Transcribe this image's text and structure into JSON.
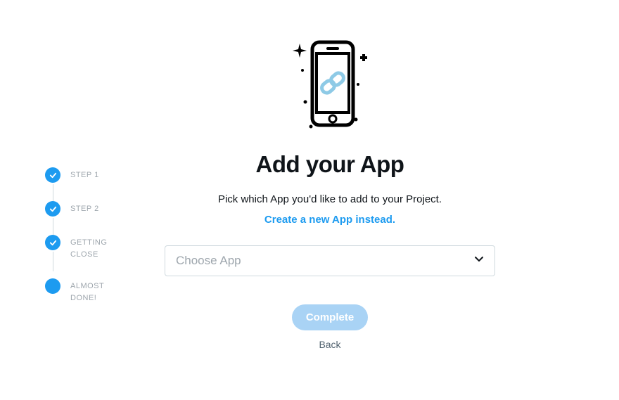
{
  "stepper": {
    "steps": [
      {
        "label": "STEP 1",
        "done": true
      },
      {
        "label": "STEP 2",
        "done": true
      },
      {
        "label": "GETTING CLOSE",
        "done": true
      },
      {
        "label": "ALMOST DONE!",
        "done": false
      }
    ]
  },
  "main": {
    "heading": "Add your App",
    "subtitle": "Pick which App you'd like to add to your Project.",
    "create_link": "Create a new App instead.",
    "select_placeholder": "Choose App",
    "complete_label": "Complete",
    "back_label": "Back"
  },
  "colors": {
    "accent": "#1d9bf0",
    "accent_disabled": "#a9d3f5"
  }
}
